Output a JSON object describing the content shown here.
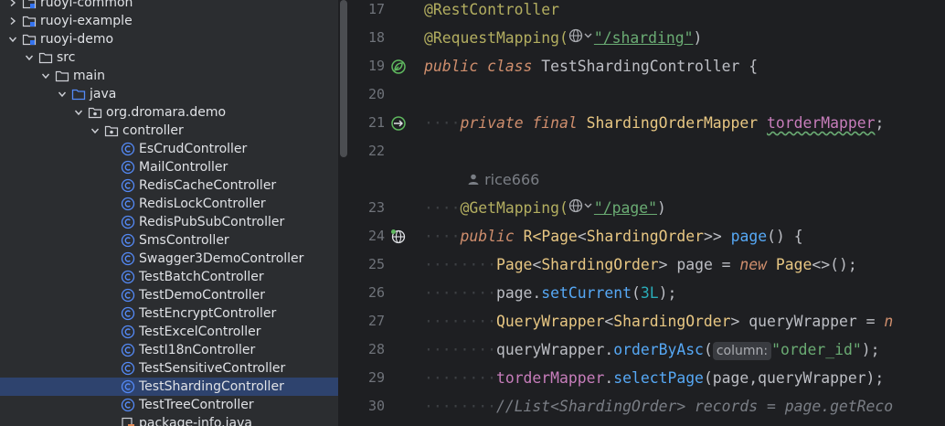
{
  "project_tree": {
    "items": [
      {
        "label": "ruoyi-common",
        "depth": 0,
        "type": "module",
        "expanded": false
      },
      {
        "label": "ruoyi-example",
        "depth": 0,
        "type": "module",
        "expanded": false
      },
      {
        "label": "ruoyi-demo",
        "depth": 0,
        "type": "module",
        "expanded": true
      },
      {
        "label": "src",
        "depth": 1,
        "type": "folder",
        "expanded": true
      },
      {
        "label": "main",
        "depth": 2,
        "type": "folder",
        "expanded": true
      },
      {
        "label": "java",
        "depth": 3,
        "type": "source-folder",
        "expanded": true
      },
      {
        "label": "org.dromara.demo",
        "depth": 4,
        "type": "package",
        "expanded": true
      },
      {
        "label": "controller",
        "depth": 5,
        "type": "package",
        "expanded": true
      },
      {
        "label": "EsCrudController",
        "depth": 6,
        "type": "class"
      },
      {
        "label": "MailController",
        "depth": 6,
        "type": "class"
      },
      {
        "label": "RedisCacheController",
        "depth": 6,
        "type": "class"
      },
      {
        "label": "RedisLockController",
        "depth": 6,
        "type": "class"
      },
      {
        "label": "RedisPubSubController",
        "depth": 6,
        "type": "class"
      },
      {
        "label": "SmsController",
        "depth": 6,
        "type": "class"
      },
      {
        "label": "Swagger3DemoController",
        "depth": 6,
        "type": "class"
      },
      {
        "label": "TestBatchController",
        "depth": 6,
        "type": "class"
      },
      {
        "label": "TestDemoController",
        "depth": 6,
        "type": "class"
      },
      {
        "label": "TestEncryptController",
        "depth": 6,
        "type": "class"
      },
      {
        "label": "TestExcelController",
        "depth": 6,
        "type": "class"
      },
      {
        "label": "TestI18nController",
        "depth": 6,
        "type": "class"
      },
      {
        "label": "TestSensitiveController",
        "depth": 6,
        "type": "class"
      },
      {
        "label": "TestShardingController",
        "depth": 6,
        "type": "class",
        "selected": true
      },
      {
        "label": "TestTreeController",
        "depth": 6,
        "type": "class"
      },
      {
        "label": "package-info.java",
        "depth": 6,
        "type": "java-file"
      }
    ]
  },
  "editor": {
    "author_hint": "rice666",
    "lines": {
      "l17": {
        "num": "17",
        "text": "@RestController"
      },
      "l18": {
        "num": "18",
        "ann": "@RequestMapping(",
        "path": "\"/sharding\"",
        "close": ")"
      },
      "l19": {
        "num": "19",
        "kw": "public class",
        "name": "TestShardingController",
        "rest": " {"
      },
      "l20": {
        "num": "20"
      },
      "l21": {
        "num": "21",
        "kw": "private final",
        "type": "ShardingOrderMapper",
        "field": "torderMapper",
        "rest": ";"
      },
      "l22": {
        "num": "22"
      },
      "l23": {
        "num": "23",
        "ann": "@GetMapping(",
        "path": "\"/page\"",
        "close": ")"
      },
      "l24": {
        "num": "24",
        "kw": "public",
        "ret_a": "R<",
        "ret_b": "Page",
        "ret_c": "<",
        "ret_d": "ShardingOrder",
        "ret_e": ">>",
        "method": "page",
        "rest": "() {"
      },
      "l25": {
        "num": "25",
        "t1": "Page",
        "t2": "<",
        "t3": "ShardingOrder",
        "t4": "> page = ",
        "kw": "new",
        "t5": "Page",
        "t6": "<>();"
      },
      "l26": {
        "num": "26",
        "obj": "page.",
        "method": "setCurrent",
        "open": "(",
        "num_lit": "3L",
        "close": ");"
      },
      "l27": {
        "num": "27",
        "t1": "QueryWrapper",
        "t2": "<",
        "t3": "ShardingOrder",
        "t4": "> queryWrapper = ",
        "kw": "n"
      },
      "l28": {
        "num": "28",
        "obj": "queryWrapper.",
        "method": "orderByAsc",
        "open": "(",
        "hint": "column:",
        "str": "\"order_id\"",
        "close": ");"
      },
      "l29": {
        "num": "29",
        "field": "torderMapper",
        "dot": ".",
        "method": "selectPage",
        "rest": "(page,queryWrapper);"
      },
      "l30": {
        "num": "30",
        "comment": "//List<ShardingOrder> records = page.getReco"
      }
    }
  },
  "colors": {
    "tree_bg": "#2b2d30",
    "editor_bg": "#1e1f22",
    "selection": "#2e436e",
    "annotation": "#b3ae60",
    "keyword": "#cf8e6d",
    "string": "#6aab73",
    "field": "#c77dbb",
    "method": "#56a8f5",
    "number": "#2aacb8",
    "comment": "#7a7e85"
  }
}
